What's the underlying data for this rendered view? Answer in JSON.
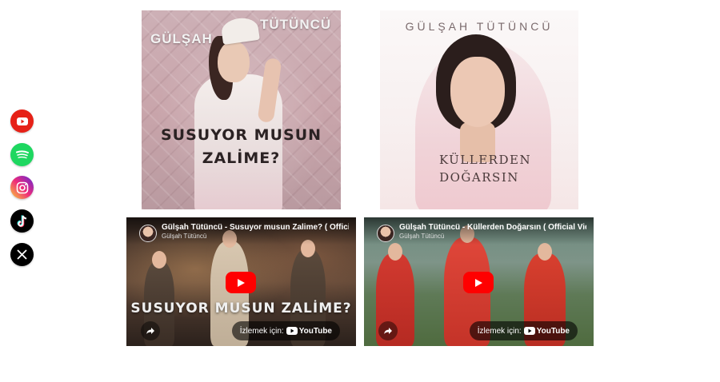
{
  "social": {
    "items": [
      {
        "name": "YouTube",
        "icon": "youtube-icon",
        "color": "#e62117"
      },
      {
        "name": "Spotify",
        "icon": "spotify-icon",
        "color": "#1ed760"
      },
      {
        "name": "Instagram",
        "icon": "instagram-icon",
        "color": "#d62976"
      },
      {
        "name": "TikTok",
        "icon": "tiktok-icon",
        "color": "#000000"
      },
      {
        "name": "X",
        "icon": "x-icon",
        "color": "#000000"
      }
    ]
  },
  "covers": [
    {
      "artist_first": "GÜLŞAH",
      "artist_last": "TÜTÜNCÜ",
      "title_line1": "SUSUYOR MUSUN",
      "title_line2": "ZALİME?"
    },
    {
      "artist": "GÜLŞAH TÜTÜNCÜ",
      "title_line1": "KÜLLERDEN",
      "title_line2": "DOĞARSIN"
    }
  ],
  "videos": [
    {
      "title": "Gülşah Tütüncü - Susuyor musun Zalime? ( Official",
      "channel": "Gülşah Tütüncü",
      "overlay_text": "SUSUYOR MUSUN ZALİME?",
      "watch_label": "İzlemek için:",
      "platform": "YouTube"
    },
    {
      "title": "Gülşah Tütüncü - Küllerden Doğarsın ( Official Vid",
      "channel": "Gülşah Tütüncü",
      "overlay_text": "",
      "watch_label": "İzlemek için:",
      "platform": "YouTube"
    }
  ]
}
